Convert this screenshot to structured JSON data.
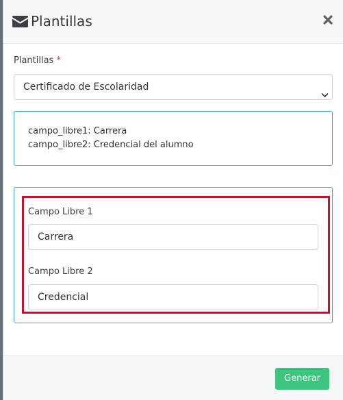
{
  "modal": {
    "title": "Plantillas",
    "title_icon": "envelope-icon",
    "close_icon": "close-icon"
  },
  "template_select": {
    "label": "Plantillas",
    "required_mark": "*",
    "value": "Certificado de Escolaridad",
    "icon": "chevron-down-icon"
  },
  "info": {
    "lines": [
      "campo_libre1: Carrera",
      "campo_libre2: Credencial del alumno"
    ]
  },
  "fields": [
    {
      "label": "Campo Libre 1",
      "value": "Carrera"
    },
    {
      "label": "Campo Libre 2",
      "value": "Credencial"
    }
  ],
  "footer": {
    "submit_label": "Generar"
  },
  "colors": {
    "accent_border": "#3aa7d9",
    "highlight": "#c8102e",
    "submit": "#3ec47e",
    "required": "#dc3545"
  }
}
